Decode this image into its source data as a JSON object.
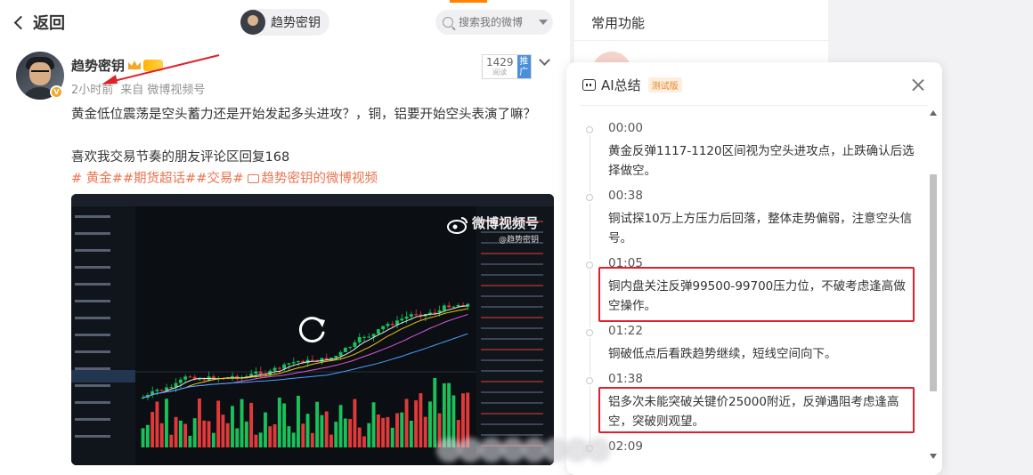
{
  "nav": {
    "back_label": "返回",
    "account_name": "趋势密钥",
    "search_placeholder": "搜索我的微博"
  },
  "post": {
    "author": "趋势密钥",
    "time": "2小时前",
    "source": "来自 微博视频号",
    "read_count": "1429",
    "read_label": "阅读",
    "promote_label": "推广",
    "line1": "黄金低位震荡是空头蓄力还是开始发起多头进攻？，铜，铝要开始空头表演了嘛？",
    "line2": "喜欢我交易节奏的朋友评论区回复168",
    "tags": "# 黄金##期货超话##交易#",
    "video_link": "趋势密钥的微博视频",
    "watermark": "微博视频号",
    "watermark_sub": "@趋势密钥"
  },
  "sidebar": {
    "common_title": "常用功能"
  },
  "ai_summary": {
    "title": "AI总结",
    "beta_tag": "测试版",
    "items": [
      {
        "time": "00:00",
        "text": "黄金反弹1117-1120区间视为空头进攻点，止跌确认后选择做空。"
      },
      {
        "time": "00:38",
        "text": "铜试探10万上方压力后回落，整体走势偏弱，注意空头信号。"
      },
      {
        "time": "01:05",
        "text": "铜内盘关注反弹99500-99700压力位，不破考虑逢高做空操作。"
      },
      {
        "time": "01:22",
        "text": "铜破低点后看跌趋势继续，短线空间向下。"
      },
      {
        "time": "01:38",
        "text": "铝多次未能突破关键价25000附近，反弹遇阻考虑逢高空，突破则观望。"
      },
      {
        "time": "02:09",
        "text": ""
      }
    ]
  },
  "colors": {
    "accent": "#ff8200",
    "tag": "#eb7350",
    "highlight": "#e0202a",
    "candle_up": "#19c15a",
    "candle_down": "#e03a3a"
  }
}
